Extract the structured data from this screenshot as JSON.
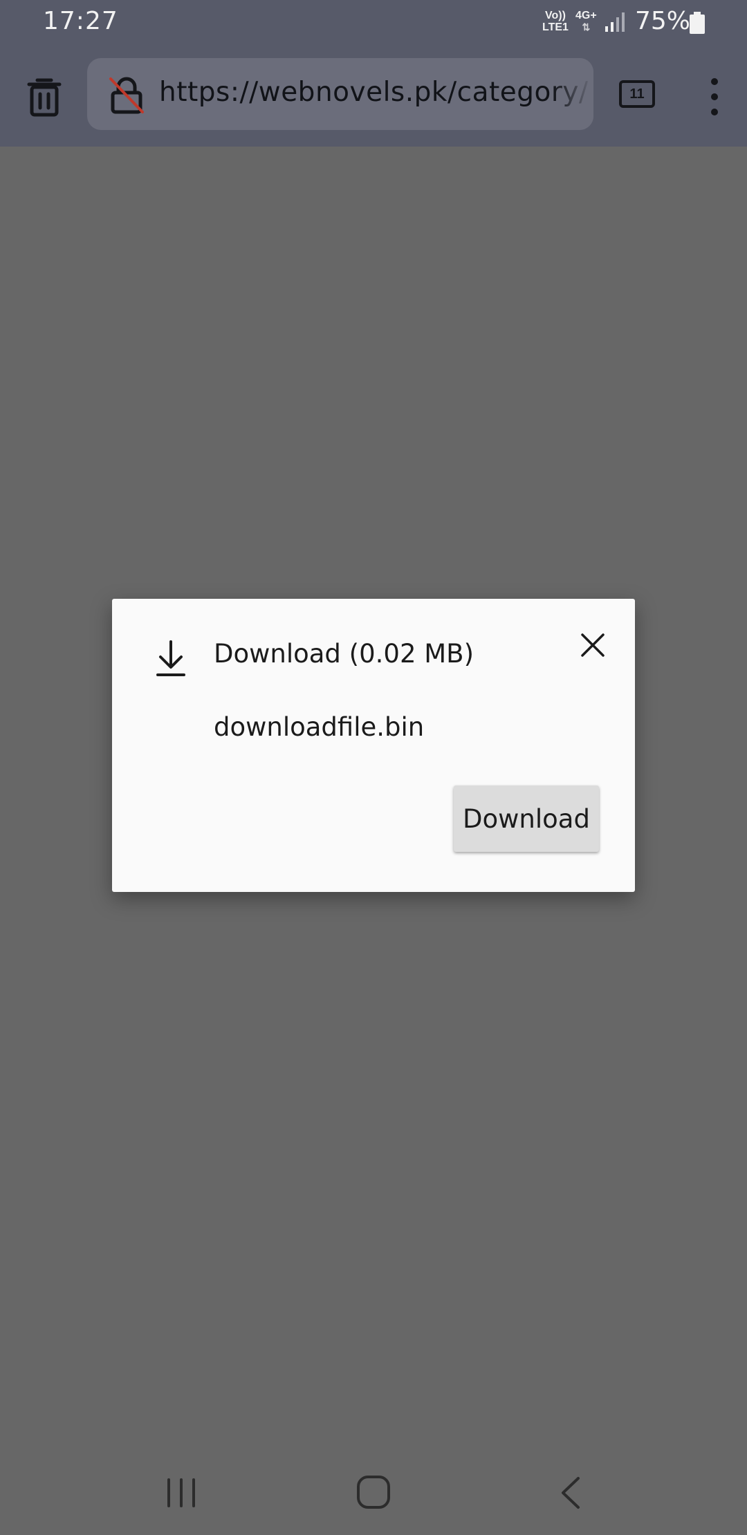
{
  "status_bar": {
    "time": "17:27",
    "volte_line1": "Vo))",
    "volte_line2": "LTE1",
    "network_type": "4G+",
    "battery_percent": "75%"
  },
  "toolbar": {
    "url": "https://webnovels.pk/category/",
    "tab_count": "11"
  },
  "dialog": {
    "title": "Download (0.02 MB)",
    "filename": "downloadfile.bin",
    "download_button_label": "Download"
  },
  "colors": {
    "toolbar_bg": "#575a69",
    "page_dim": "#676767",
    "dialog_bg": "#fafafa",
    "button_bg": "#dcdcdc",
    "lock_slash": "#c0392b"
  },
  "icons": [
    "trash-icon",
    "insecure-lock-icon",
    "tabs-icon",
    "more-vert-icon",
    "download-icon",
    "close-icon",
    "recents-icon",
    "home-icon",
    "back-icon"
  ]
}
